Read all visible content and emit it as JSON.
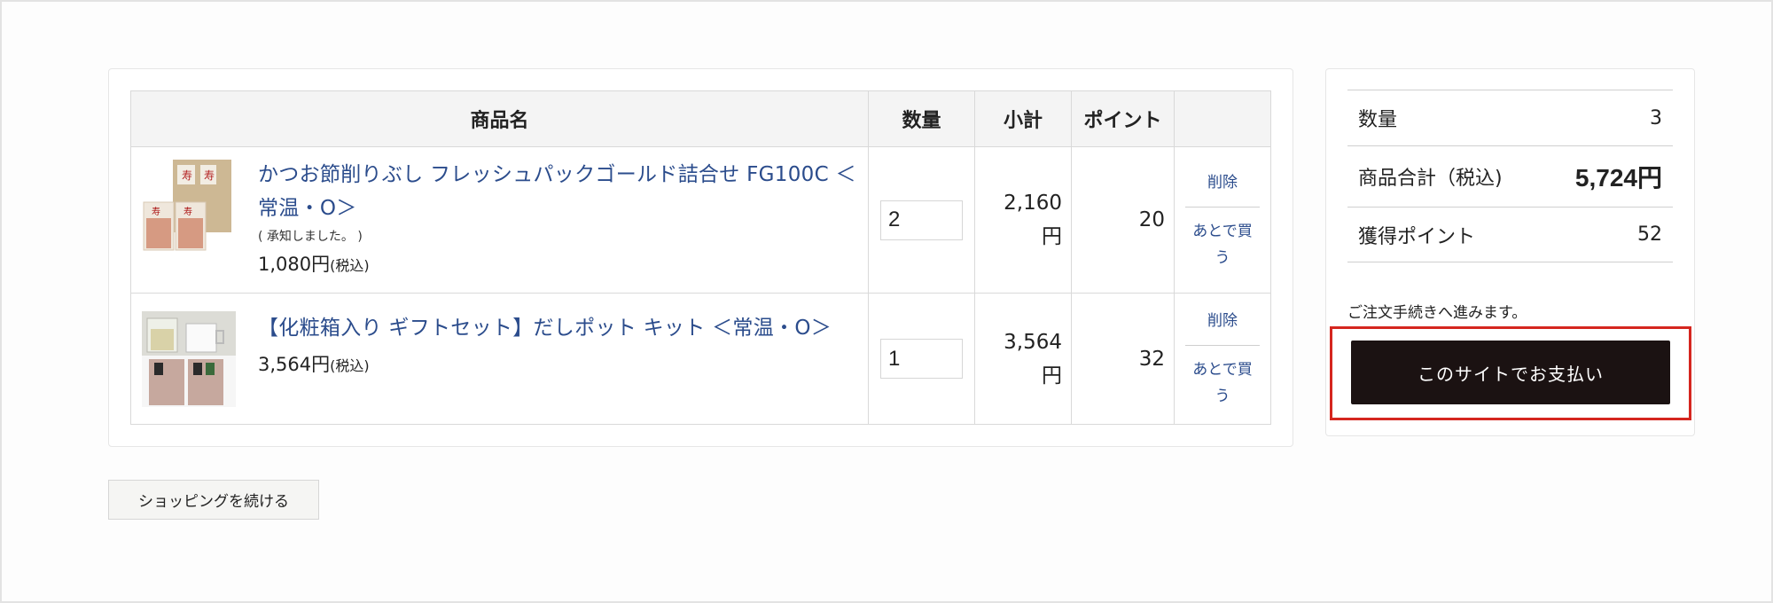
{
  "cart": {
    "headers": {
      "product": "商品名",
      "quantity": "数量",
      "subtotal": "小計",
      "points": "ポイント",
      "actions": ""
    },
    "items": [
      {
        "name": "かつお節削りぶし フレッシュパックゴールド詰合せ FG100C ＜常温・O＞",
        "note": "( 承知しました。 )",
        "price": "1,080円",
        "tax_label": "(税込)",
        "quantity": "2",
        "subtotal_num": "2,160",
        "subtotal_unit": "円",
        "points": "20",
        "delete_label": "削除",
        "later_label": "あとで買う"
      },
      {
        "name": "【化粧箱入り ギフトセット】だしポット キット ＜常温・O＞",
        "note": "",
        "price": "3,564円",
        "tax_label": "(税込)",
        "quantity": "1",
        "subtotal_num": "3,564",
        "subtotal_unit": "円",
        "points": "32",
        "delete_label": "削除",
        "later_label": "あとで買う"
      }
    ]
  },
  "summary": {
    "quantity_label": "数量",
    "quantity_value": "3",
    "total_label": "商品合計（税込)",
    "total_value": "5,724円",
    "points_label": "獲得ポイント",
    "points_value": "52",
    "proceed_note": "ご注文手続きへ進みます。",
    "pay_button": "このサイトでお支払い"
  },
  "continue_button": "ショッピングを続ける",
  "colors": {
    "link": "#2b4c8c",
    "pay_button_bg": "#1b1212",
    "highlight": "#d5261f"
  }
}
